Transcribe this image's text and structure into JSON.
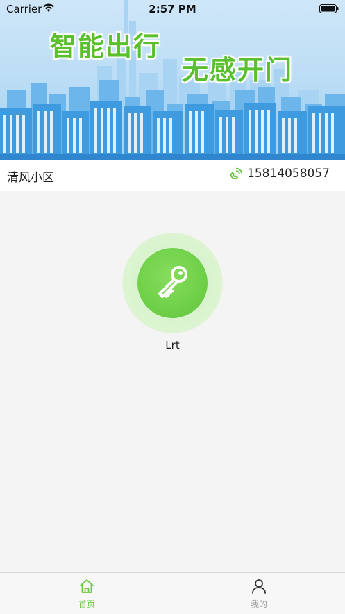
{
  "status_bar": {
    "carrier": "Carrier",
    "time": "2:57 PM"
  },
  "banner": {
    "slogan_line1": "智能出行",
    "slogan_line2": "无感开门",
    "slogan_color": "#5bc02d"
  },
  "info_bar": {
    "community_name": "清风小区",
    "phone_number": "15814058057",
    "phone_icon": "phone-icon"
  },
  "door_key": {
    "label": "Lrt",
    "icon": "key-icon",
    "accent_color": "#6fd048"
  },
  "tab_bar": {
    "tabs": [
      {
        "label": "首页",
        "icon": "home-icon",
        "active": true
      },
      {
        "label": "我的",
        "icon": "person-icon",
        "active": false
      }
    ],
    "active_color": "#6cc643",
    "inactive_color": "#9a9a9a"
  }
}
